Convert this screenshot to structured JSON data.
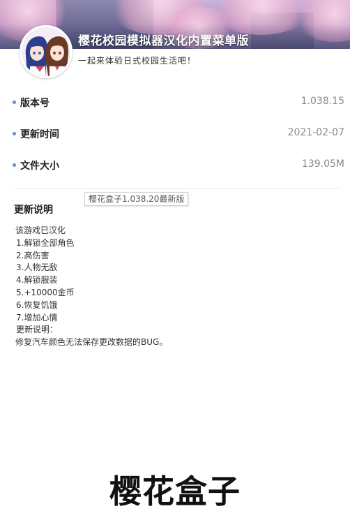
{
  "header": {
    "app_title": "樱花校园模拟器汉化内置菜单版",
    "subtitle": "一起来体验日式校园生活吧！"
  },
  "info": [
    {
      "label": "版本号",
      "value": "1.038.15"
    },
    {
      "label": "更新时间",
      "value": "2021-02-07"
    },
    {
      "label": "文件大小",
      "value": "139.05M"
    }
  ],
  "update_section": {
    "title": "更新说明",
    "tooltip": "樱花盒子1.038.20最新版",
    "lines": [
      "该游戏已汉化",
      " 1.解锁全部角色",
      " 2.高伤害",
      " 3.人物无敌",
      " 4.解锁服装",
      " 5.+10000金币",
      " 6.恢复饥饿",
      " 7.增加心情",
      " 更新说明：",
      " 修复汽车颜色无法保存更改数据的BUG。"
    ]
  },
  "watermark": "樱花盒子",
  "colors": {
    "bullet": "#5b8fd6",
    "banner_sky": "#b79bc9",
    "blossom": "#ecaacd"
  },
  "icons": {
    "avatar": "anime-characters-icon",
    "bullet": "dot-icon"
  }
}
